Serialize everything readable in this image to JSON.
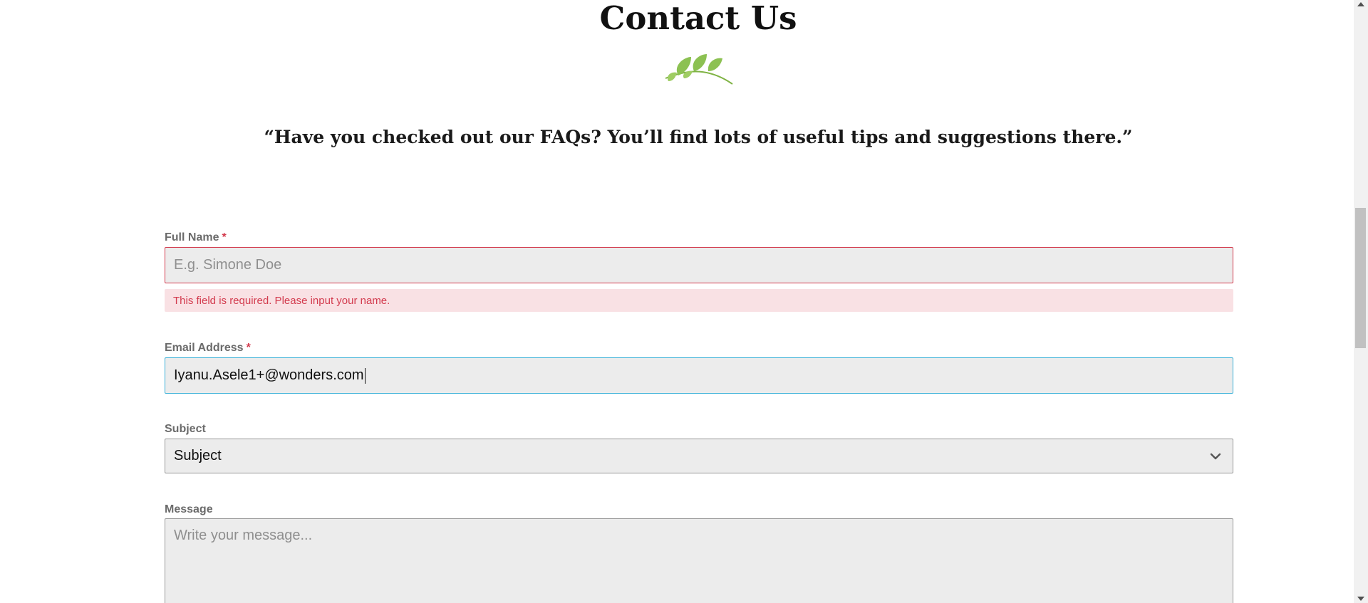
{
  "header": {
    "title": "Contact Us",
    "quote": "“Have you checked out our FAQs? You’ll find lots of useful tips and suggestions there.”"
  },
  "form": {
    "full_name": {
      "label": "Full Name",
      "required_mark": "*",
      "placeholder": "E.g. Simone Doe",
      "value": "",
      "error": "This field is required. Please input your name."
    },
    "email": {
      "label": "Email Address",
      "required_mark": "*",
      "value": "Iyanu.Asele1+@wonders.com"
    },
    "subject": {
      "label": "Subject",
      "selected": "Subject"
    },
    "message": {
      "label": "Message",
      "placeholder": "Write your message..."
    }
  },
  "icons": {
    "sprig": "leaf-sprig-icon",
    "select": "chevron-down-icon"
  },
  "colors": {
    "error": "#d33b4e",
    "error_bg": "#f9e1e4",
    "focus": "#3bb1d8",
    "input_bg": "#ececec",
    "sprig": "#8cc152"
  }
}
